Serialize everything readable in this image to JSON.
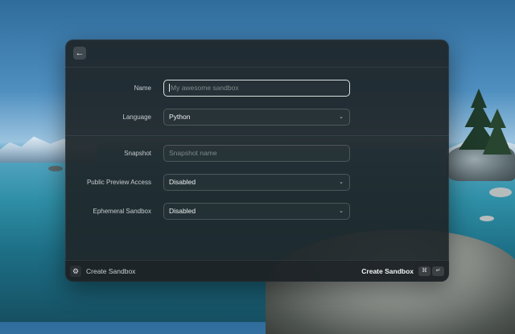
{
  "window": {
    "back_icon": "arrow-left-icon"
  },
  "form": {
    "name": {
      "label": "Name",
      "placeholder": "My awesome sandbox",
      "value": ""
    },
    "language": {
      "label": "Language",
      "value": "Python"
    },
    "snapshot": {
      "label": "Snapshot",
      "placeholder": "Snapshot name",
      "value": ""
    },
    "public_preview": {
      "label": "Public Preview Access",
      "value": "Disabled"
    },
    "ephemeral": {
      "label": "Ephemeral Sandbox",
      "value": "Disabled"
    }
  },
  "footer": {
    "icon": "gear-icon",
    "title": "Create Sandbox",
    "action_label": "Create Sandbox",
    "shortcut_cmd": "⌘",
    "shortcut_return": "↵"
  },
  "colors": {
    "window_bg": "#1e2629",
    "focus_border": "#d9dedf"
  }
}
